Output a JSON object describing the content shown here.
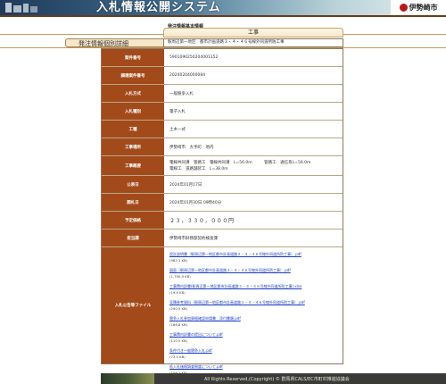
{
  "header": {
    "title": "入札情報公開システム",
    "city": "伊勢崎市"
  },
  "section": {
    "basic_info": "発注情報基本情報",
    "work_type": "工事",
    "detail": "発注情報個別詳細"
  },
  "summary_row": {
    "text": "駅周辺第一地区　都市計画道路３・４・４６号線外同道所防工事"
  },
  "rows": [
    {
      "label": "案件番号",
      "value": "5901090250204001152"
    },
    {
      "label": "調達案件番号",
      "value": "20240204000084"
    },
    {
      "label": "入札方式",
      "value": "一般競争入札"
    },
    {
      "label": "入札種別",
      "value": "電子入札"
    },
    {
      "label": "工種",
      "value": "土木一式"
    },
    {
      "label": "工事場所",
      "value": "伊勢崎市　大手町　地内"
    },
    {
      "label": "工事概要",
      "value_lines": [
        "電線共同溝　管路工　電線共同溝　L=56.0m　　　管路工　通信系L=56.0m",
        "電線工　道路舗装工　L=38.0m"
      ]
    },
    {
      "label": "公表日",
      "value": "2024年01月17日"
    },
    {
      "label": "開札日",
      "value": "2024年01月30日 09時40分"
    },
    {
      "label": "予定価格",
      "value": "２３，３３０，０００円"
    },
    {
      "label": "担当課",
      "value": "伊勢崎市財務部契約検査課"
    }
  ],
  "files": {
    "label": "入札公告等ファイル",
    "items": [
      {
        "name": "設計説明書（駅周辺第一地区都市計画道路３・４・４６号線外同道所防工事）.pdf",
        "size": "(982.1 KB)"
      },
      {
        "name": "図面（駅周辺第一地区都市計画道路３・４・４６号線外同道所防工事）.pdf",
        "size": "(1,790.9 KB)"
      },
      {
        "name": "工事費内訳書(駅周辺第一地区都市計画道路３・４・４６号線外同道所防工事).xlsx",
        "size": "(19.9 KB)"
      },
      {
        "name": "見積参考資料（駅周辺第一地区都市計画道路３・４・４６号線外同道所防工事）.pdf",
        "size": "(290.5 KB)"
      },
      {
        "name": "競争入札参加資格確認申請書＿添付書類.pdf",
        "size": "(166.8 KB)"
      },
      {
        "name": "工事費内訳書の提出について.pdf",
        "size": "(110.5 KB)"
      },
      {
        "name": "条件付き一般競争入札.pdf",
        "size": "(73.5 KB)"
      },
      {
        "name": "低入札価格調査制度について.pdf",
        "size": "(108.2 KB)"
      }
    ]
  },
  "footer": {
    "text": "All Rights Reserved,(Copyright) © 群馬県CALS/EC市町村推進協議会"
  },
  "colors": {
    "label_bg": "#a34a1a",
    "link": "#1a3ec8",
    "header_dark": "#1f3a5a"
  }
}
